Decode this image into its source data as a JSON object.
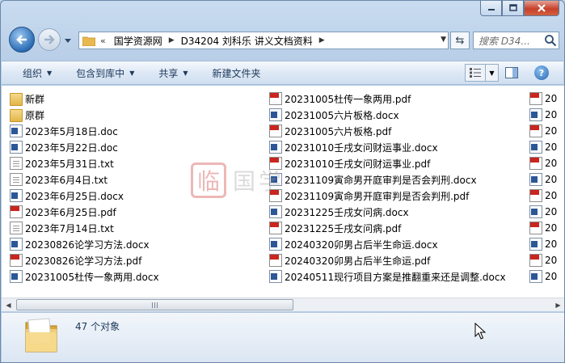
{
  "window": {
    "caption_buttons": [
      "minimize",
      "maximize",
      "close"
    ]
  },
  "navigation": {
    "breadcrumb_chevron": "«",
    "breadcrumb": [
      "国学资源网",
      "D34204 刘科乐 讲义文档资料"
    ],
    "search_placeholder": "搜索 D34..."
  },
  "toolbar": {
    "organize": "组织",
    "include_in_library": "包含到库中",
    "share": "共享",
    "new_folder": "新建文件夹"
  },
  "files": {
    "col1": [
      {
        "name": "新群",
        "type": "folder"
      },
      {
        "name": "原群",
        "type": "folder"
      },
      {
        "name": "2023年5月18日.doc",
        "type": "doc"
      },
      {
        "name": "2023年5月22日.doc",
        "type": "doc"
      },
      {
        "name": "2023年5月31日.txt",
        "type": "txt"
      },
      {
        "name": "2023年6月4日.txt",
        "type": "txt"
      },
      {
        "name": "2023年6月25日.docx",
        "type": "doc"
      },
      {
        "name": "2023年6月25日.pdf",
        "type": "pdf"
      },
      {
        "name": "2023年7月14日.txt",
        "type": "txt"
      },
      {
        "name": "20230826论学习方法.docx",
        "type": "doc"
      },
      {
        "name": "20230826论学习方法.pdf",
        "type": "pdf"
      },
      {
        "name": "20231005杜传一象两用.docx",
        "type": "doc"
      }
    ],
    "col2": [
      {
        "name": "20231005杜传一象两用.pdf",
        "type": "pdf"
      },
      {
        "name": "20231005六片板格.docx",
        "type": "doc"
      },
      {
        "name": "20231005六片板格.pdf",
        "type": "pdf"
      },
      {
        "name": "20231010壬戌女问财运事业.docx",
        "type": "doc"
      },
      {
        "name": "20231010壬戌女问财运事业.pdf",
        "type": "pdf"
      },
      {
        "name": "20231109寅命男开庭审判是否会判刑.docx",
        "type": "doc"
      },
      {
        "name": "20231109寅命男开庭审判是否会判刑.pdf",
        "type": "pdf"
      },
      {
        "name": "20231225壬戌女问病.docx",
        "type": "doc"
      },
      {
        "name": "20231225壬戌女问病.pdf",
        "type": "pdf"
      },
      {
        "name": "20240320卯男占后半生命运.docx",
        "type": "doc"
      },
      {
        "name": "20240320卯男占后半生命运.pdf",
        "type": "pdf"
      },
      {
        "name": "20240511现行项目方案是推翻重来还是调整.docx",
        "type": "doc"
      }
    ],
    "col3": [
      {
        "name": "20",
        "type": "pdf"
      },
      {
        "name": "20",
        "type": "doc"
      },
      {
        "name": "20",
        "type": "pdf"
      },
      {
        "name": "20",
        "type": "doc"
      },
      {
        "name": "20",
        "type": "pdf"
      },
      {
        "name": "20",
        "type": "doc"
      },
      {
        "name": "20",
        "type": "pdf"
      },
      {
        "name": "20",
        "type": "doc"
      },
      {
        "name": "20",
        "type": "pdf"
      },
      {
        "name": "20",
        "type": "doc"
      },
      {
        "name": "20",
        "type": "pdf"
      },
      {
        "name": "20",
        "type": "doc"
      }
    ]
  },
  "watermark": {
    "seal": "临",
    "text": "国学"
  },
  "details": {
    "item_count": "47 个对象"
  },
  "icons": {
    "back": "back-arrow-icon",
    "forward": "forward-arrow-icon",
    "refresh": "refresh-icon",
    "search": "search-icon",
    "help": "help-icon"
  },
  "colors": {
    "toolbar_text": "#1e395b",
    "close_button": "#c7402a",
    "pdf_red": "#c8261f",
    "word_blue": "#2b5797"
  }
}
